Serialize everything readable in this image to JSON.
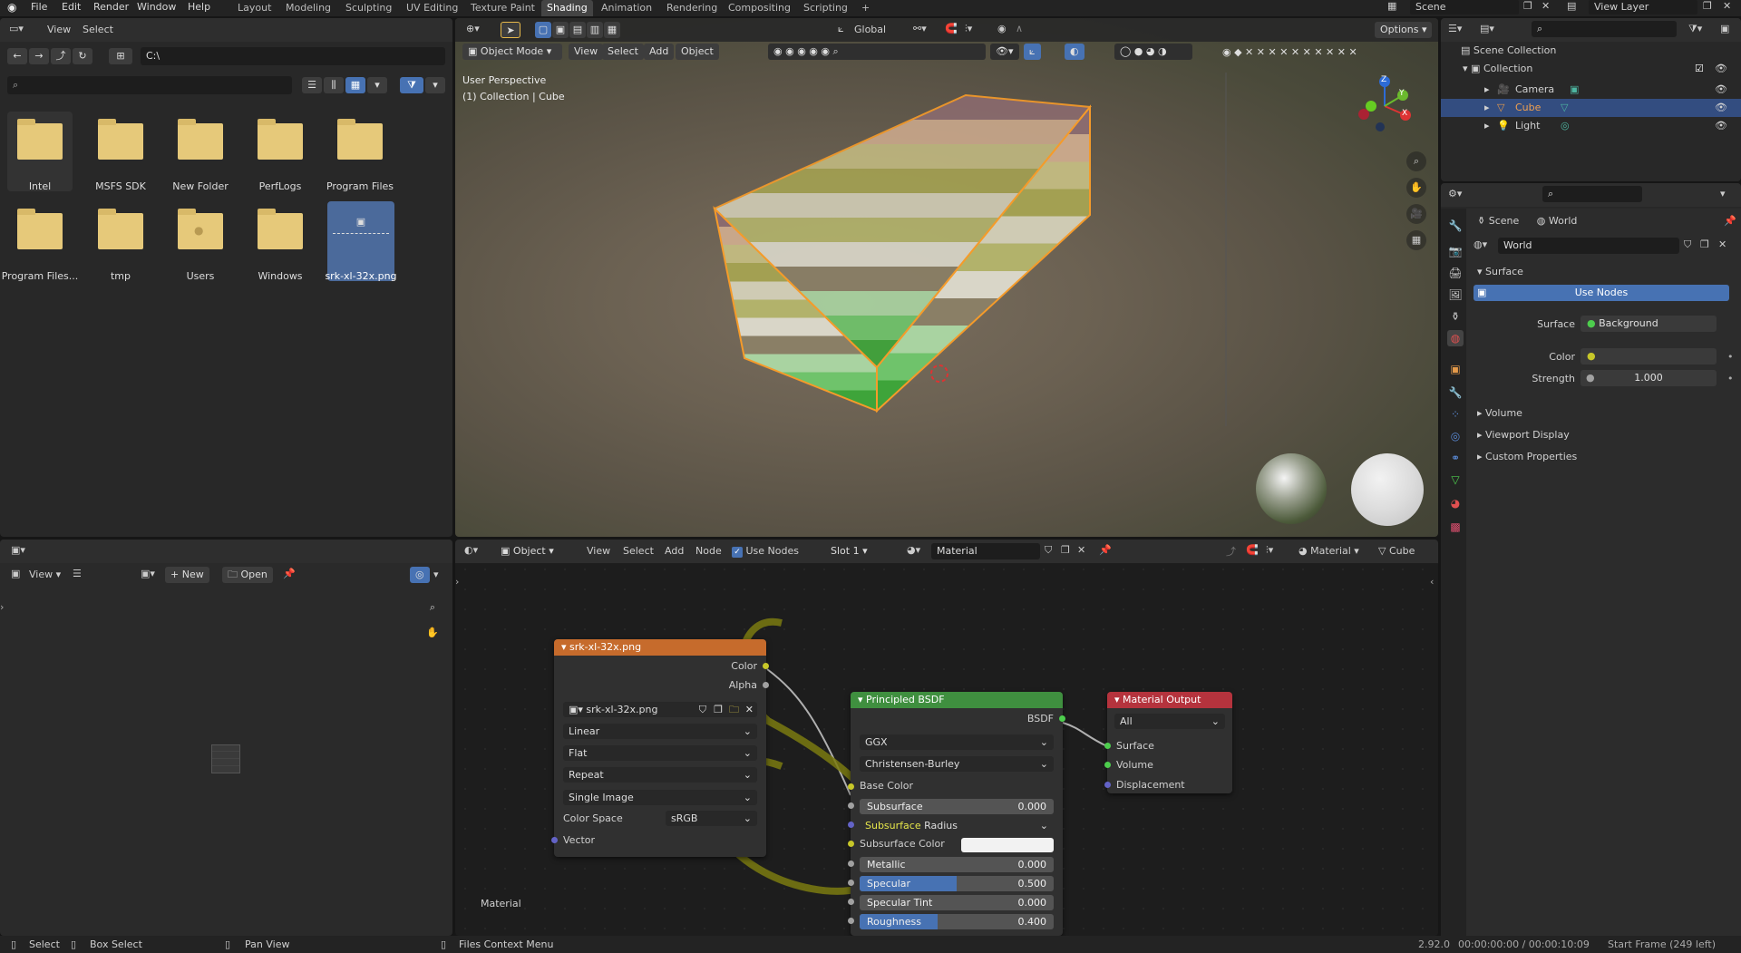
{
  "topbar": {
    "menus": [
      "File",
      "Edit",
      "Render",
      "Window",
      "Help"
    ],
    "workspaces": [
      "Layout",
      "Modeling",
      "Sculpting",
      "UV Editing",
      "Texture Paint",
      "Shading",
      "Animation",
      "Rendering",
      "Compositing",
      "Scripting"
    ],
    "active_workspace": "Shading",
    "add_tab": "+",
    "scene": "Scene",
    "view_layer": "View Layer"
  },
  "file_browser": {
    "menus": [
      "View",
      "Select"
    ],
    "path": "C:\\",
    "search_placeholder": "",
    "items": [
      {
        "name": "Intel",
        "type": "folder",
        "selected": false,
        "hover": true
      },
      {
        "name": "MSFS SDK",
        "type": "folder",
        "selected": false
      },
      {
        "name": "New Folder",
        "type": "folder",
        "selected": false
      },
      {
        "name": "PerfLogs",
        "type": "folder",
        "selected": false
      },
      {
        "name": "Program Files",
        "type": "folder",
        "selected": false
      },
      {
        "name": "Program Files...",
        "type": "folder",
        "selected": false
      },
      {
        "name": "tmp",
        "type": "folder",
        "selected": false
      },
      {
        "name": "Users",
        "type": "folder",
        "selected": false
      },
      {
        "name": "Windows",
        "type": "folder",
        "selected": false
      },
      {
        "name": "srk-xl-32x.png",
        "type": "image",
        "selected": true
      }
    ]
  },
  "viewport": {
    "mode": "Object Mode",
    "menus": [
      "View",
      "Select",
      "Add",
      "Object"
    ],
    "orientation": "Global",
    "options": "Options",
    "overlay_line1": "User Perspective",
    "overlay_line2": "(1) Collection | Cube",
    "gizmo_axes": [
      "X",
      "Y",
      "Z"
    ]
  },
  "outliner": {
    "root": "Scene Collection",
    "collection": "Collection",
    "items": [
      {
        "name": "Camera",
        "selected": false,
        "color": "#e59a4a"
      },
      {
        "name": "Cube",
        "selected": true,
        "color": "#e59a4a"
      },
      {
        "name": "Light",
        "selected": false,
        "color": "#e59a4a"
      }
    ]
  },
  "properties": {
    "breadcrumb": [
      "Scene",
      "World"
    ],
    "world_name": "World",
    "sections": {
      "surface": "Surface",
      "volume": "Volume",
      "viewport_display": "Viewport Display",
      "custom_properties": "Custom Properties"
    },
    "use_nodes": "Use Nodes",
    "surface_label": "Surface",
    "surface_value": "Background",
    "color_label": "Color",
    "strength_label": "Strength",
    "strength_value": "1.000"
  },
  "image_editor": {
    "view": "View",
    "new": "New",
    "open": "Open"
  },
  "node_editor": {
    "type": "Object",
    "menus": [
      "View",
      "Select",
      "Add",
      "Node"
    ],
    "use_nodes": "Use Nodes",
    "slot": "Slot 1",
    "material": "Material",
    "material_right": "Material",
    "object_right": "Cube",
    "tree_label": "Material",
    "image_node": {
      "title": "srk-xl-32x.png",
      "out_color": "Color",
      "out_alpha": "Alpha",
      "image_name": "srk-xl-32x.png",
      "interpolation": "Linear",
      "projection": "Flat",
      "extension": "Repeat",
      "source": "Single Image",
      "color_space_label": "Color Space",
      "color_space": "sRGB",
      "in_vector": "Vector"
    },
    "bsdf_node": {
      "title": "Principled BSDF",
      "out_bsdf": "BSDF",
      "distribution": "GGX",
      "subsurface_method": "Christensen-Burley",
      "base_color": "Base Color",
      "subsurface_label": "Subsurface",
      "subsurface": 0.0,
      "subsurface_text": "0.000",
      "subsurface_radius_a": "Subsurface",
      "subsurface_radius_b": "Radius",
      "subsurface_color": "Subsurface Color",
      "metallic_label": "Metallic",
      "metallic": 0.0,
      "metallic_text": "0.000",
      "specular_label": "Specular",
      "specular": 0.5,
      "specular_text": "0.500",
      "specular_tint_label": "Specular Tint",
      "specular_tint": 0.0,
      "specular_tint_text": "0.000",
      "roughness_label": "Roughness",
      "roughness": 0.4,
      "roughness_text": "0.400"
    },
    "output_node": {
      "title": "Material Output",
      "target": "All",
      "surface": "Surface",
      "volume": "Volume",
      "displacement": "Displacement"
    }
  },
  "statusbar": {
    "select": "Select",
    "box_select": "Box Select",
    "pan_view": "Pan View",
    "context_menu": "Files Context Menu",
    "version": "2.92.0",
    "time": "00:00:00:00 / 00:00:10:09",
    "frame": "Start Frame (249 left)"
  },
  "colors": {
    "accent": "#4772b3",
    "image_node_header": "#c66b2c",
    "shader_node_header": "#3f8f3f",
    "output_node_header": "#b5333d",
    "socket_color": "#c7c729",
    "socket_shader": "#4dcd4d",
    "socket_vector": "#6363c7",
    "socket_float": "#a1a1a1"
  }
}
